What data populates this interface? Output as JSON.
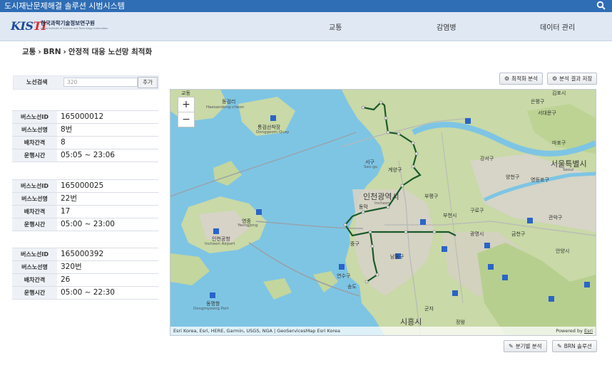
{
  "app": {
    "title": "도시재난문제해결 솔루션 시범시스템"
  },
  "logo": {
    "mark_k": "KIS",
    "mark_ti": "TI",
    "korean": "한국과학기술정보연구원",
    "english": "Korea Institute of Science and Technology Information"
  },
  "nav": {
    "items": [
      "교통",
      "감염병",
      "데이터 관리"
    ]
  },
  "breadcrumb": [
    "교통",
    "BRN",
    "안정적 대응 노선망 최적화"
  ],
  "search": {
    "label": "노선검색",
    "value": "320",
    "add_label": "추가"
  },
  "routes": [
    {
      "id_label": "버스노선ID",
      "id": "165000012",
      "name_label": "버스노선명",
      "name": "8번",
      "interval_label": "배차간격",
      "interval": "8",
      "hours_label": "운행시간",
      "hours": "05:05 ~ 23:06"
    },
    {
      "id_label": "버스노선ID",
      "id": "165000025",
      "name_label": "버스노선명",
      "name": "22번",
      "interval_label": "배차간격",
      "interval": "17",
      "hours_label": "운행시간",
      "hours": "05:00 ~ 23:00"
    },
    {
      "id_label": "버스노선ID",
      "id": "165000392",
      "name_label": "버스노선명",
      "name": "320번",
      "interval_label": "배차간격",
      "interval": "26",
      "hours_label": "운행시간",
      "hours": "05:00 ~ 22:30"
    }
  ],
  "buttons": {
    "optimize": "최적화 분석",
    "save": "분석 결과 저장",
    "branch": "분기별 분석",
    "brn": "BRN 솔루션"
  },
  "map": {
    "zoom_in": "+",
    "zoom_out": "−",
    "attribution": "Esri Korea, Esri, HERE, Garmin, USGS, NGA | GeoServicesMap Esri Korea",
    "powered_prefix": "Powered by ",
    "powered_brand": "Esri",
    "labels": {
      "incheon": "인천광역시",
      "incheon_en": "Incheon",
      "seoul": "서울특별시",
      "seoul_en": "Seoul",
      "airport": "인천공항",
      "airport_en": "Incheon Airport",
      "gyeyang": "계양구",
      "bupyeong": "부평구",
      "namdong": "남동구",
      "yeonsu": "연수구",
      "yeongjong": "영종",
      "yeongjong_en": "Yeongjong",
      "seo": "서구",
      "seo_en": "Seo-gu",
      "siheung": "시흥시",
      "ganghwa": "교동",
      "gimpo": "김포시",
      "guro": "구로구",
      "gangseo": "강서구",
      "mapo": "마포구",
      "seodaemun": "서대문구",
      "eunpyeong": "은평구",
      "yangcheon": "양천구",
      "yeongdeungpo": "영등포구",
      "gwanak": "관악구",
      "geumcheon": "금천구",
      "gwangmyeong": "광명시",
      "anyang": "안양시",
      "bucheon": "부천시",
      "junggu": "중구",
      "dongmak": "동막",
      "songdo": "송도",
      "gunja": "군자",
      "jeongwang": "정왕",
      "incheon_port": "동명항",
      "port_en": "Dongmyeong Port",
      "dongrim": "동검리",
      "donggeom": "통검선착장",
      "donggeom_en": "Donggeom Quay",
      "haesan": "Haesandong-cheon"
    }
  }
}
